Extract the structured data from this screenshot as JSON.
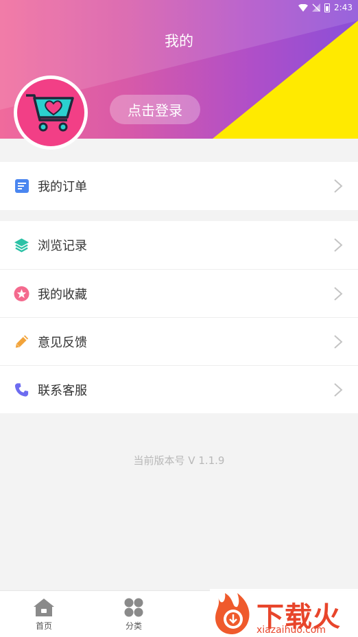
{
  "status_bar": {
    "time": "2:43"
  },
  "header": {
    "title": "我的",
    "login_label": "点击登录"
  },
  "menu_group_1": [
    {
      "label": "我的订单",
      "icon": "order-doc-icon",
      "color": "#4a86f0"
    }
  ],
  "menu_group_2": [
    {
      "label": "浏览记录",
      "icon": "layers-icon",
      "color": "#2cc2a6"
    },
    {
      "label": "我的收藏",
      "icon": "star-circle-icon",
      "color": "#f46a8e"
    },
    {
      "label": "意见反馈",
      "icon": "pencil-icon",
      "color": "#f2a33a"
    },
    {
      "label": "联系客服",
      "icon": "phone-icon",
      "color": "#6d6cf0"
    }
  ],
  "version_text": "当前版本号 V 1.1.9",
  "tabbar": [
    {
      "label": "首页",
      "icon": "home-icon"
    },
    {
      "label": "分类",
      "icon": "category-icon"
    }
  ],
  "watermark": {
    "text": "下载火",
    "sub": "xiazaihuo.com"
  },
  "colors": {
    "header_pink": "#f06a9c",
    "header_purple": "#8a4fd8",
    "accent_yellow": "#ffea00",
    "avatar_pink": "#f23f86"
  }
}
